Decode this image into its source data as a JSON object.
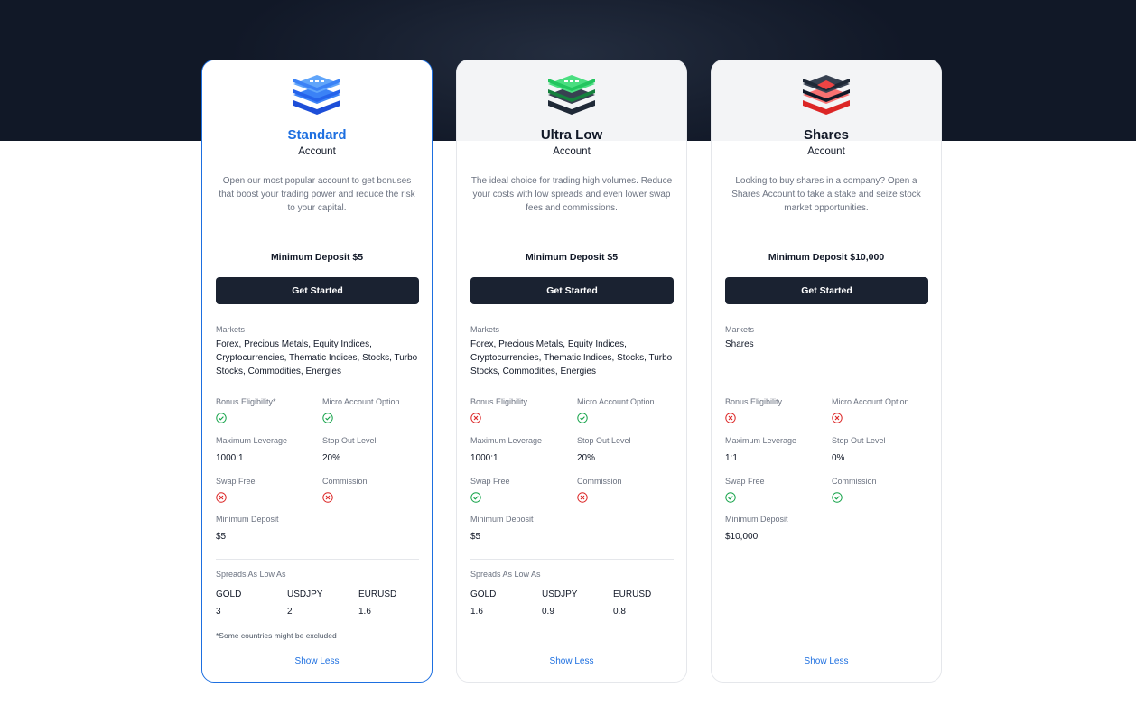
{
  "colors": {
    "check": "#16a34a",
    "cross": "#dc2626",
    "accent": "#1d6fe0",
    "dark": "#111827"
  },
  "labels": {
    "markets": "Markets",
    "max_leverage": "Maximum Leverage",
    "stop_out": "Stop Out Level",
    "swap_free": "Swap Free",
    "commission": "Commission",
    "min_deposit": "Minimum Deposit",
    "spreads": "Spreads As Low As",
    "cta": "Get Started",
    "show_less": "Show Less",
    "subtitle": "Account"
  },
  "cards": [
    {
      "title": "Standard",
      "icon": "blue-layers-icon",
      "description": "Open our most popular account to get bonuses that boost your trading power and reduce the risk to your capital.",
      "min_deposit_heading": "Minimum Deposit $5",
      "markets": "Forex, Precious Metals, Equity Indices, Cryptocurrencies, Thematic Indices, Stocks, Turbo Stocks, Commodities, Energies",
      "bonus_label": "Bonus Eligibility*",
      "bonus": "check",
      "micro_label": "Micro Account Option",
      "micro": "check",
      "max_leverage": "1000:1",
      "stop_out": "20%",
      "swap_free": "cross",
      "commission": "cross",
      "min_deposit": "$5",
      "spreads": [
        {
          "symbol": "GOLD",
          "value": "3"
        },
        {
          "symbol": "USDJPY",
          "value": "2"
        },
        {
          "symbol": "EURUSD",
          "value": "1.6"
        }
      ],
      "footnote": "*Some countries might be excluded"
    },
    {
      "title": "Ultra Low",
      "icon": "green-layers-icon",
      "description": "The ideal choice for trading high volumes. Reduce your costs with low spreads and even lower swap fees and commissions.",
      "min_deposit_heading": "Minimum Deposit $5",
      "markets": "Forex, Precious Metals, Equity Indices, Cryptocurrencies, Thematic Indices, Stocks, Turbo Stocks, Commodities, Energies",
      "bonus_label": "Bonus Eligibility",
      "bonus": "cross",
      "micro_label": "Micro Account Option",
      "micro": "check",
      "max_leverage": "1000:1",
      "stop_out": "20%",
      "swap_free": "check",
      "commission": "cross",
      "min_deposit": "$5",
      "spreads": [
        {
          "symbol": "GOLD",
          "value": "1.6"
        },
        {
          "symbol": "USDJPY",
          "value": "0.9"
        },
        {
          "symbol": "EURUSD",
          "value": "0.8"
        }
      ]
    },
    {
      "title": "Shares",
      "icon": "red-layers-icon",
      "description": "Looking to buy shares in a company? Open a Shares Account to take a stake and seize stock market opportunities.",
      "min_deposit_heading": "Minimum Deposit $10,000",
      "markets": "Shares",
      "bonus_label": "Bonus Eligibility",
      "bonus": "cross",
      "micro_label": "Micro Account Option",
      "micro": "cross",
      "max_leverage": "1:1",
      "stop_out": "0%",
      "swap_free": "check",
      "commission": "check",
      "min_deposit": "$10,000"
    }
  ]
}
